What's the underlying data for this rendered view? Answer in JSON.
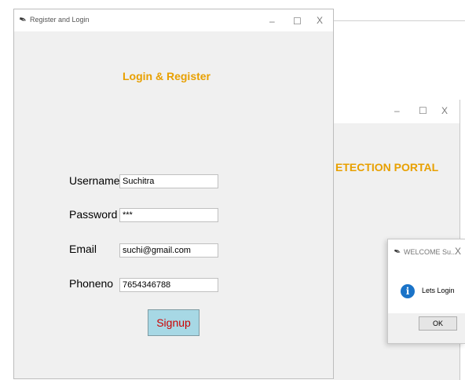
{
  "back_window": {
    "controls": {
      "minimize": "–",
      "maximize": "☐",
      "close": "X"
    },
    "heading_fragment": "ETECTION PORTAL"
  },
  "main_window": {
    "title": "Register and Login",
    "controls": {
      "minimize": "–",
      "maximize": "☐",
      "close": "X"
    },
    "heading": "Login & Register",
    "fields": {
      "username": {
        "label": "Username",
        "value": "Suchitra"
      },
      "password": {
        "label": "Password",
        "value": "***"
      },
      "email": {
        "label": "Email",
        "value": "suchi@gmail.com"
      },
      "phoneno": {
        "label": "Phoneno",
        "value": "7654346788"
      }
    },
    "signup_label": "Signup"
  },
  "dialog": {
    "title": "WELCOME Su...",
    "close": "X",
    "message": "Lets Login",
    "ok_label": "OK",
    "icon": "info-icon"
  },
  "colors": {
    "heading": "#e8a000",
    "signup_bg": "#a7d8e5",
    "signup_text": "#cc0000",
    "info_icon": "#1a73c8"
  }
}
